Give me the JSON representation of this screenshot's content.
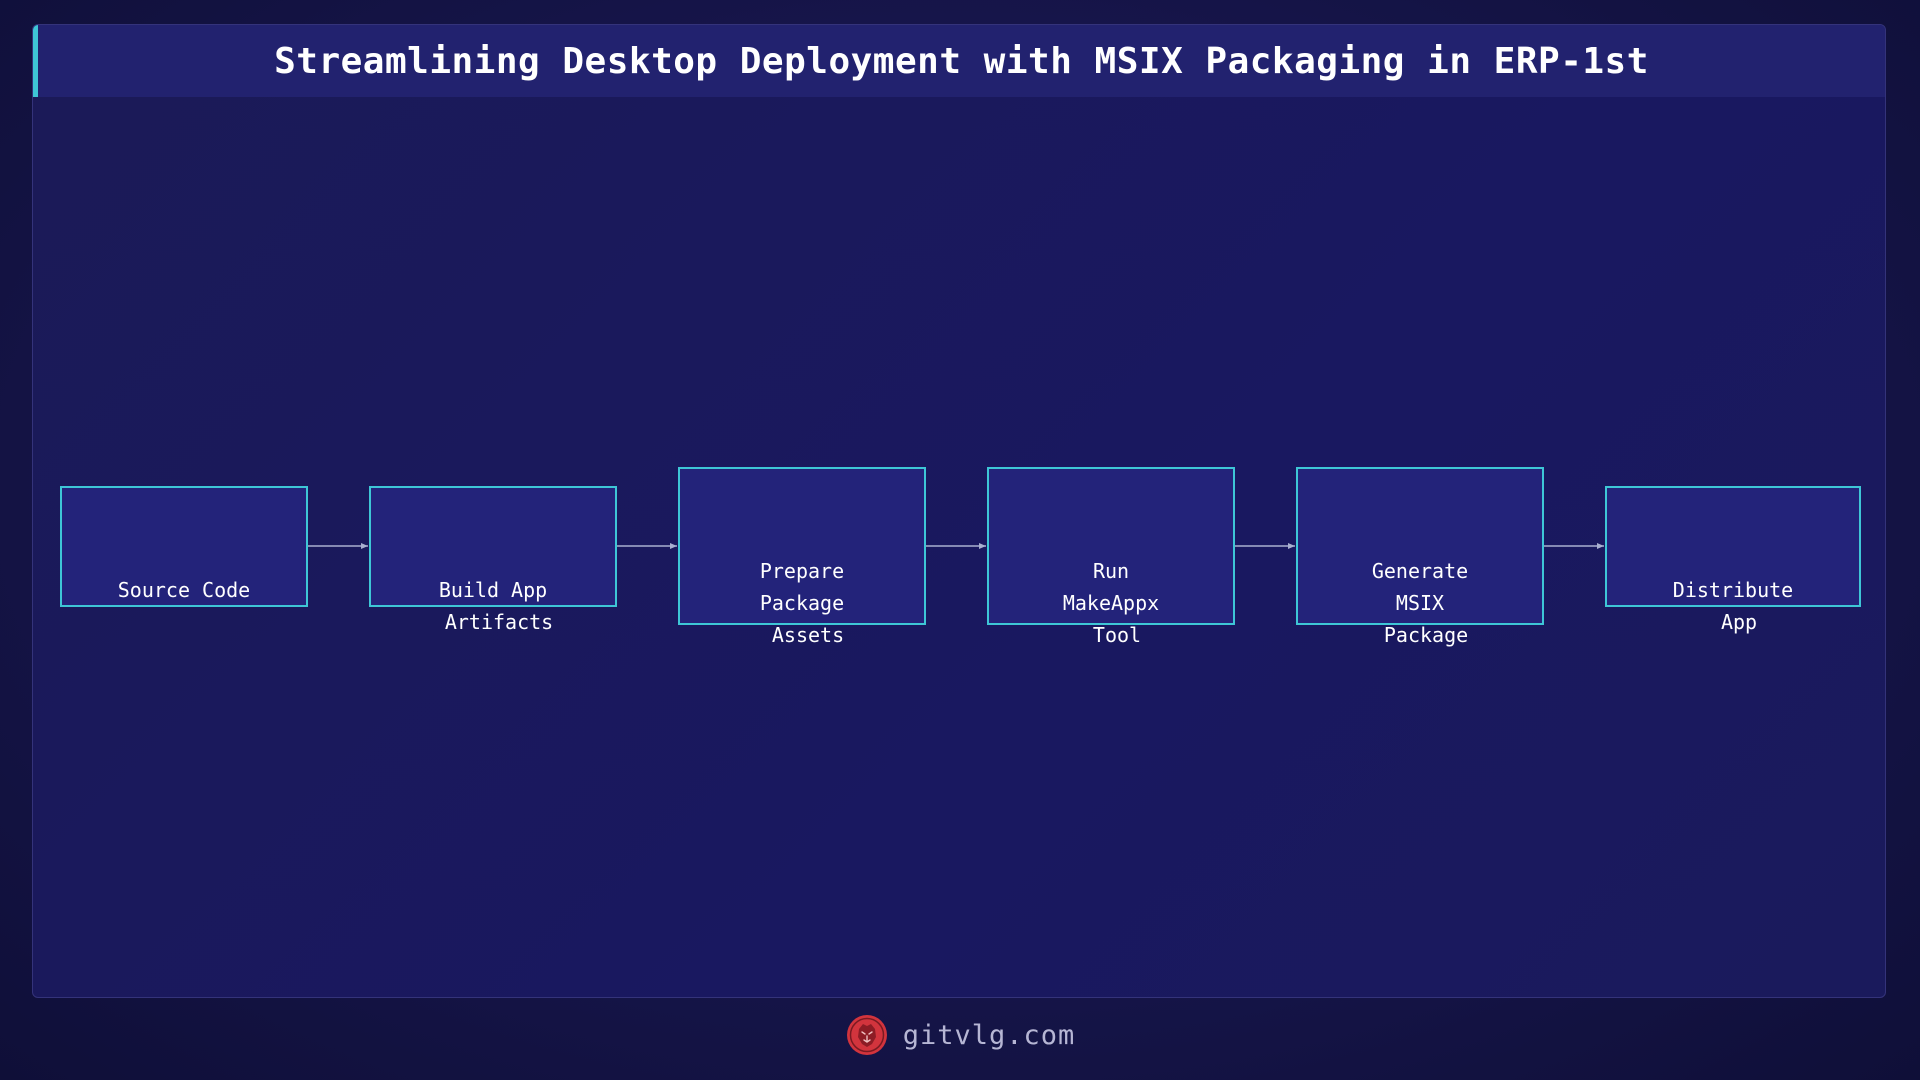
{
  "title": "Streamlining Desktop Deployment with MSIX Packaging in ERP-1st",
  "nodes": [
    {
      "label": "Source Code"
    },
    {
      "label": "Build App\n Artifacts"
    },
    {
      "label": "Prepare\nPackage\n Assets"
    },
    {
      "label": "Run\nMakeAppx\n Tool"
    },
    {
      "label": "Generate\nMSIX\n Package"
    },
    {
      "label": "Distribute\n App"
    }
  ],
  "footer": {
    "brand": "gitvlg.com",
    "logo_icon": "lion-icon"
  },
  "colors": {
    "accent": "#3ec6d6",
    "node_fill": "#23237a",
    "header_fill": "#22226f",
    "arrow": "#a9b0d0",
    "logo": "#d2343d"
  }
}
